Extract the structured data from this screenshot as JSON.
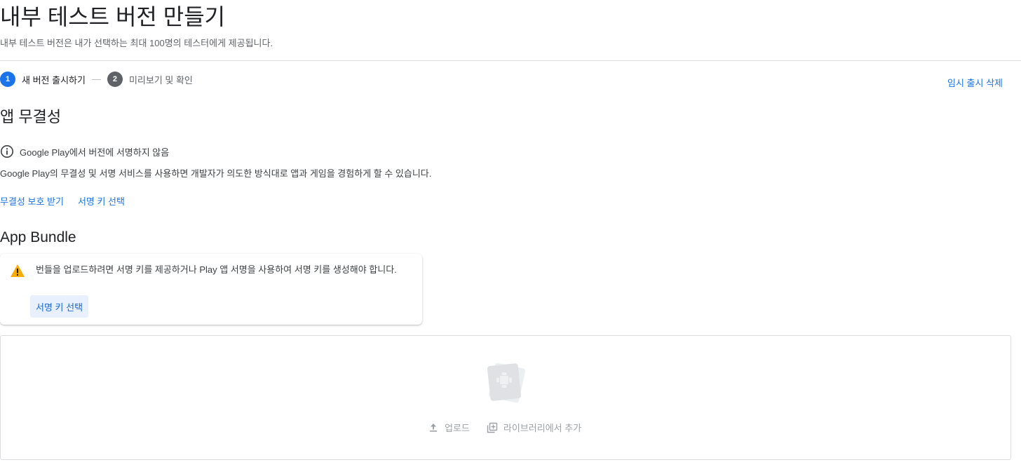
{
  "header": {
    "title": "내부 테스트 버전 만들기",
    "subtitle": "내부 테스트 버전은 내가 선택하는 최대 100명의 테스터에게 제공됩니다."
  },
  "stepper": {
    "steps": [
      {
        "number": "1",
        "label": "새 버전 출시하기",
        "state": "active"
      },
      {
        "number": "2",
        "label": "미리보기 및 확인",
        "state": "inactive"
      }
    ],
    "discard_label": "임시 출시 삭제"
  },
  "app_integrity": {
    "title": "앱 무결성",
    "info_icon": "info-icon",
    "info_text": "Google Play에서 버전에 서명하지 않음",
    "description": "Google Play의 무결성 및 서명 서비스를 사용하면 개발자가 의도한 방식대로 앱과 게임을 경험하게 할 수 있습니다.",
    "links": [
      "무결성 보호 받기",
      "서명 키 선택"
    ]
  },
  "app_bundle": {
    "title": "App Bundle",
    "warning_icon": "warning-icon",
    "warning_text": "번들을 업로드하려면 서명 키를 제공하거나 Play 앱 서명을 사용하여 서명 키를 생성해야 합니다.",
    "button_label": "서명 키 선택",
    "upload_label": "업로드",
    "library_label": "라이브러리에서 추가"
  },
  "colors": {
    "accent": "#1a73e8",
    "warning": "#f9ab00",
    "text_primary": "#202124",
    "text_secondary": "#5f6368",
    "disabled": "#9aa0a6"
  }
}
